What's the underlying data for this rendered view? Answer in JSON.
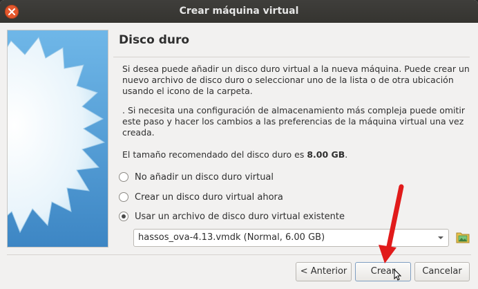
{
  "window": {
    "title": "Crear máquina virtual"
  },
  "page": {
    "title": "Disco duro"
  },
  "texts": {
    "p1": "Si desea puede añadir un disco duro virtual a la nueva máquina. Puede crear un nuevo archivo de disco duro o seleccionar uno de la lista o de otra ubicación usando el icono de la carpeta.",
    "p2": ". Si necesita una configuración de almacenamiento más compleja puede omitir este paso y hacer los cambios a las preferencias de la máquina virtual una vez creada.",
    "p3_prefix": "El tamaño recomendado del disco duro es ",
    "p3_size": "8.00 GB",
    "p3_suffix": "."
  },
  "options": [
    {
      "label": "No añadir un disco duro virtual",
      "checked": false
    },
    {
      "label": "Crear un disco duro virtual ahora",
      "checked": false
    },
    {
      "label": "Usar un archivo de disco duro virtual existente",
      "checked": true
    }
  ],
  "disk_select": {
    "value": "hassos_ova-4.13.vmdk (Normal, 6.00 GB)"
  },
  "buttons": {
    "back": "< Anterior",
    "create": "Crear",
    "cancel": "Cancelar"
  },
  "icons": {
    "close": "close-icon",
    "dropdown": "chevron-down-icon",
    "folder": "folder-image-icon",
    "side": "starburst-illustration"
  },
  "colors": {
    "titlebar": "#3a3935",
    "close": "#e4582d",
    "side_bg": "#5aa5d8",
    "annotation": "#e11b1b"
  }
}
